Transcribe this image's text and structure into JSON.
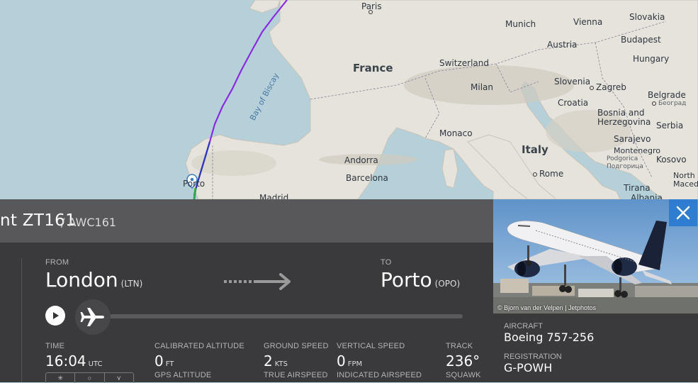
{
  "map": {
    "labels": {
      "paris": "Paris",
      "munich": "Munich",
      "vienna": "Vienna",
      "slovakia": "Slovakia",
      "budapest": "Budapest",
      "austria": "Austria",
      "hungary": "Hungary",
      "france": "France",
      "switzerland": "Switzerland",
      "slovenia": "Slovenia",
      "zagreb": "Zagreb",
      "belgrade": "Belgrade",
      "belgrade_cyr": "Београд",
      "milan": "Milan",
      "croatia": "Croatia",
      "bay_of_biscay": "Bay of Biscay",
      "bosnia": "Bosnia and Herzegovina",
      "serbia": "Serbia",
      "sarajevo": "Sarajevo",
      "monaco": "Monaco",
      "montenegro": "Montenegro",
      "podgorica": "Podgorica",
      "podgorica_cyr": "Подгорица",
      "kosovo": "Kosovo",
      "italy": "Italy",
      "andorra": "Andorra",
      "barcelona": "Barcelona",
      "rome": "Rome",
      "north_macedonia": "North Macedonia",
      "tirana": "Tirana",
      "albania": "Albania",
      "porto_partial": "Porto",
      "madrid_partial": "Madrid"
    }
  },
  "flight": {
    "flight_number": "nt ZT161",
    "callsign": "/ AWC161",
    "from_label": "FROM",
    "from_city": "London",
    "from_code": "(LTN)",
    "to_label": "TO",
    "to_city": "Porto",
    "to_code": "(OPO)",
    "progress": 0.0
  },
  "stats": {
    "time_label": "TIME",
    "time_value": "16:04",
    "time_unit": "UTC",
    "cal_alt_label": "CALIBRATED ALTITUDE",
    "cal_alt_value": "0",
    "cal_alt_unit": "FT",
    "gps_alt_label": "GPS ALTITUDE",
    "ground_speed_label": "GROUND SPEED",
    "ground_speed_value": "2",
    "ground_speed_unit": "KTS",
    "true_airspeed_label": "TRUE AIRSPEED",
    "vertical_speed_label": "VERTICAL SPEED",
    "vertical_speed_value": "0",
    "vertical_speed_unit": "FPM",
    "indicated_airspeed_label": "INDICATED AIRSPEED",
    "track_label": "TRACK",
    "track_value": "236°",
    "squawk_label": "SQUAWK"
  },
  "aircraft": {
    "photo_credit": "© Bjorn van der Velpen | Jetphotos",
    "aircraft_label": "AIRCRAFT",
    "aircraft_value": "Boeing 757-256",
    "registration_label": "REGISTRATION",
    "registration_value": "G-POWH"
  },
  "colors": {
    "land": "#e6e3dc",
    "sea": "#b5d0d8",
    "track_purple": "#8a2be2",
    "close_blue": "#2e7dd1"
  },
  "icons": [
    "play-icon",
    "airplane-icon",
    "arrow-right-icon",
    "close-icon",
    "location-pin-icon"
  ]
}
